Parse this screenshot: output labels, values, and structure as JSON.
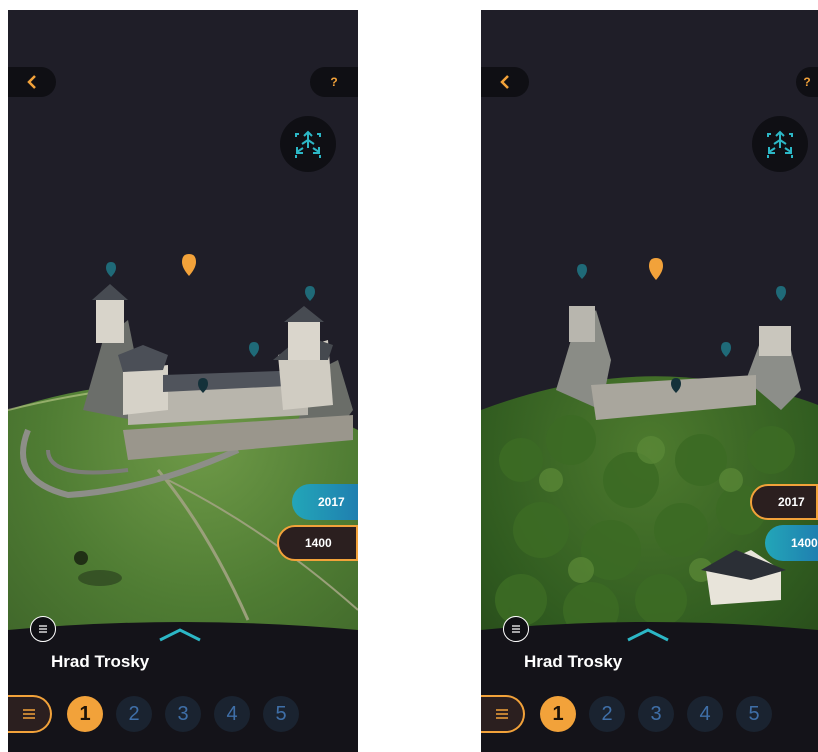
{
  "screens": [
    {
      "id": "left",
      "title": "Hrad Trosky",
      "help_label": "?",
      "years": [
        {
          "label": "2017",
          "style": "teal"
        },
        {
          "label": "1400",
          "style": "selected"
        }
      ],
      "pages": [
        "1",
        "2",
        "3",
        "4",
        "5"
      ],
      "active_page": "1"
    },
    {
      "id": "right",
      "title": "Hrad Trosky",
      "help_label": "?",
      "years": [
        {
          "label": "2017",
          "style": "selected"
        },
        {
          "label": "1400",
          "style": "teal"
        }
      ],
      "pages": [
        "1",
        "2",
        "3",
        "4",
        "5"
      ],
      "active_page": "1"
    }
  ],
  "colors": {
    "accent": "#f2a23a",
    "teal": "#23a6b8",
    "background": "#1f1e28",
    "panel": "#0f0f14",
    "inactive_number": "#3f6fa8"
  },
  "icons": [
    "back-chevron-icon",
    "help-icon",
    "3d-view-icon",
    "map-pin-icon",
    "layers-icon",
    "chevron-up-icon",
    "menu-icon"
  ]
}
